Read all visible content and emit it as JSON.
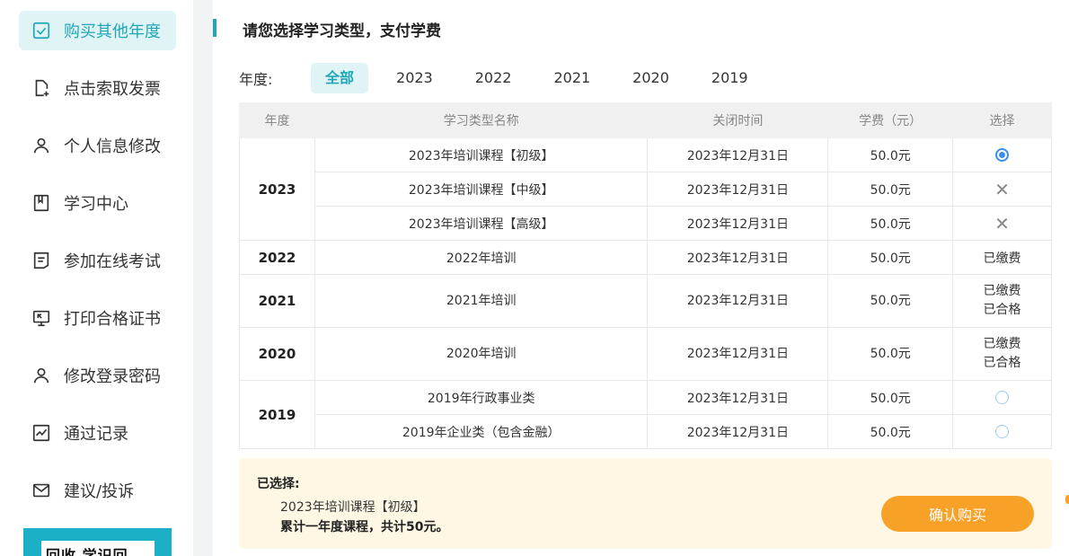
{
  "sidebar": {
    "items": [
      {
        "label": "购买其他年度",
        "icon": "checkbox-icon",
        "active": true
      },
      {
        "label": "点击索取发票",
        "icon": "add-document-icon"
      },
      {
        "label": "个人信息修改",
        "icon": "user-icon"
      },
      {
        "label": "学习中心",
        "icon": "book-icon"
      },
      {
        "label": "参加在线考试",
        "icon": "exam-icon"
      },
      {
        "label": "打印合格证书",
        "icon": "certificate-icon"
      },
      {
        "label": "修改登录密码",
        "icon": "user-lock-icon"
      },
      {
        "label": "通过记录",
        "icon": "chart-icon"
      },
      {
        "label": "建议/投诉",
        "icon": "mail-icon"
      }
    ],
    "qr_text": "回收 学识回"
  },
  "main": {
    "title": "请您选择学习类型，支付学费",
    "year_label": "年度:",
    "year_tabs": [
      "全部",
      "2023",
      "2022",
      "2021",
      "2020",
      "2019"
    ],
    "table": {
      "headers": [
        "年度",
        "学习类型名称",
        "关闭时间",
        "学费（元）",
        "选择"
      ],
      "rows": [
        {
          "year": "2023",
          "name": "2023年培训课程【初级】",
          "close": "2023年12月31日",
          "fee": "50.0元",
          "select": "radio-checked"
        },
        {
          "name": "2023年培训课程【中级】",
          "close": "2023年12月31日",
          "fee": "50.0元",
          "select": "x"
        },
        {
          "name": "2023年培训课程【高级】",
          "close": "2023年12月31日",
          "fee": "50.0元",
          "select": "x"
        },
        {
          "year": "2022",
          "name": "2022年培训",
          "close": "2023年12月31日",
          "fee": "50.0元",
          "status": "已缴费"
        },
        {
          "year": "2021",
          "name": "2021年培训",
          "close": "2023年12月31日",
          "fee": "50.0元",
          "status": "已缴费",
          "status2": "已合格"
        },
        {
          "year": "2020",
          "name": "2020年培训",
          "close": "2023年12月31日",
          "fee": "50.0元",
          "status": "已缴费",
          "status2": "已合格"
        },
        {
          "year": "2019",
          "name": "2019年行政事业类",
          "close": "2023年12月31日",
          "fee": "50.0元",
          "select": "radio"
        },
        {
          "name": "2019年企业类（包含金融）",
          "close": "2023年12月31日",
          "fee": "50.0元",
          "select": "radio"
        }
      ]
    },
    "summary": {
      "label": "已选择:",
      "item": "2023年培训课程【初级】",
      "total": "累计一年度课程，共计50元。",
      "confirm": "确认购买"
    }
  },
  "colors": {
    "accent": "#1fa7b7",
    "button": "#f7a129",
    "summary_bg": "#fdf7e4"
  }
}
